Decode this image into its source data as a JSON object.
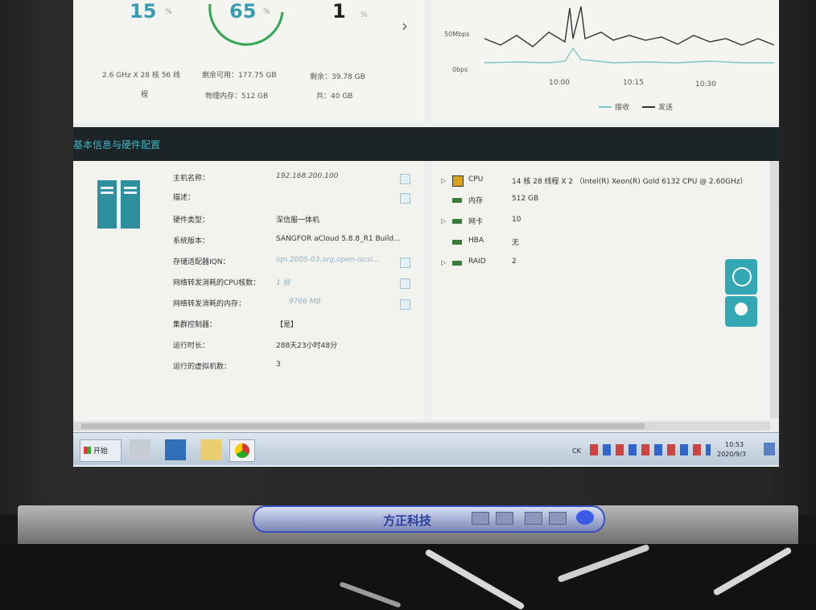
{
  "stats": {
    "cpu_pct": "15",
    "cpu_unit": "%",
    "cpu_spec_line1": "2.6 GHz X 28 核 56 线",
    "cpu_spec_line2": "程",
    "mem_pct": "65",
    "mem_unit": "%",
    "mem_available": "剩余可用：177.75 GB",
    "mem_physical": "物理内存：512 GB",
    "disk_pct": "1",
    "disk_unit": "%",
    "disk_remaining": "剩余：39.78 GB",
    "disk_total": "共：40 GB",
    "next_arrow": "›"
  },
  "chart_data": {
    "type": "line",
    "y_tick_labels": [
      "50Mbps",
      "0bps"
    ],
    "x_tick_labels": [
      "10:00",
      "10:15",
      "10:30"
    ],
    "series": [
      {
        "name": "接收",
        "color": "#7fc6c8"
      },
      {
        "name": "发送",
        "color": "#333333"
      }
    ]
  },
  "section": {
    "title": "基本信息与硬件配置"
  },
  "info": {
    "rows": [
      {
        "label": "主机名称：",
        "value": "192.168.200.100"
      },
      {
        "label": "描述：",
        "value": ""
      },
      {
        "label": "硬件类型：",
        "value": "深信服一体机"
      },
      {
        "label": "系统版本：",
        "value": "SANGFOR aCloud 5.8.8_R1 Build..."
      },
      {
        "label": "存储适配器IQN：",
        "value": "iqn.2005-03.org.open-iscsi..."
      },
      {
        "label": "网络转发消耗的CPU核数：",
        "value": "1 核"
      },
      {
        "label": "网络转发消耗的内存：",
        "value": "9766 MB"
      },
      {
        "label": "集群控制器：",
        "value": "【是】"
      },
      {
        "label": "运行时长：",
        "value": "288天23小时48分"
      },
      {
        "label": "运行的虚拟机数：",
        "value": "3"
      }
    ]
  },
  "hardware": {
    "rows": [
      {
        "label": "CPU",
        "value": "14 核 28 线程 X 2 （Intel(R) Xeon(R) Gold 6132 CPU @ 2.60GHz）"
      },
      {
        "label": "内存",
        "value": "512 GB"
      },
      {
        "label": "网卡",
        "value": "10"
      },
      {
        "label": "HBA",
        "value": "无"
      },
      {
        "label": "RAID",
        "value": "2"
      }
    ]
  },
  "taskbar": {
    "start_label": "开始",
    "tray_lang": "CK",
    "clock_time": "10:53",
    "clock_date": "2020/9/3"
  },
  "monitor": {
    "brand": "方正科技"
  }
}
